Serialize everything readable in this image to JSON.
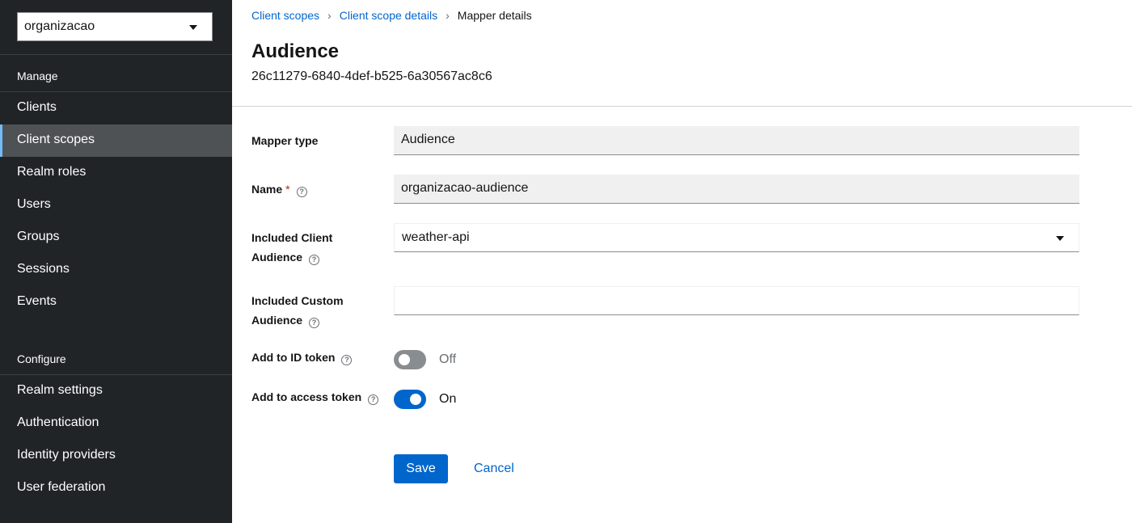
{
  "sidebar": {
    "realm_selector": "organizacao",
    "manage_title": "Manage",
    "manage_items": [
      "Clients",
      "Client scopes",
      "Realm roles",
      "Users",
      "Groups",
      "Sessions",
      "Events"
    ],
    "active_item": "Client scopes",
    "configure_title": "Configure",
    "configure_items": [
      "Realm settings",
      "Authentication",
      "Identity providers",
      "User federation"
    ]
  },
  "breadcrumb": {
    "items": [
      "Client scopes",
      "Client scope details"
    ],
    "current": "Mapper details"
  },
  "header": {
    "title": "Audience",
    "subtitle": "26c11279-6840-4def-b525-6a30567ac8c6"
  },
  "form": {
    "mapper_type_label": "Mapper type",
    "mapper_type_value": "Audience",
    "name_label": "Name",
    "name_required_mark": "*",
    "name_value": "organizacao-audience",
    "included_client_audience_label_line1": "Included Client",
    "included_client_audience_label_line2": "Audience",
    "included_client_audience_value": "weather-api",
    "included_custom_audience_label_line1": "Included Custom",
    "included_custom_audience_label_line2": "Audience",
    "included_custom_audience_value": "",
    "add_to_id_token_label": "Add to ID token",
    "add_to_id_token_state": "Off",
    "add_to_access_token_label": "Add to access token",
    "add_to_access_token_state": "On"
  },
  "actions": {
    "save": "Save",
    "cancel": "Cancel"
  },
  "colors": {
    "sidebar_bg": "#212427",
    "active_item_bg": "#4f5255",
    "primary": "#0066cc",
    "link": "#0066cc",
    "required": "#c9190b"
  },
  "icons": {
    "help": "help-circle-icon",
    "dropdown": "caret-down-icon"
  }
}
